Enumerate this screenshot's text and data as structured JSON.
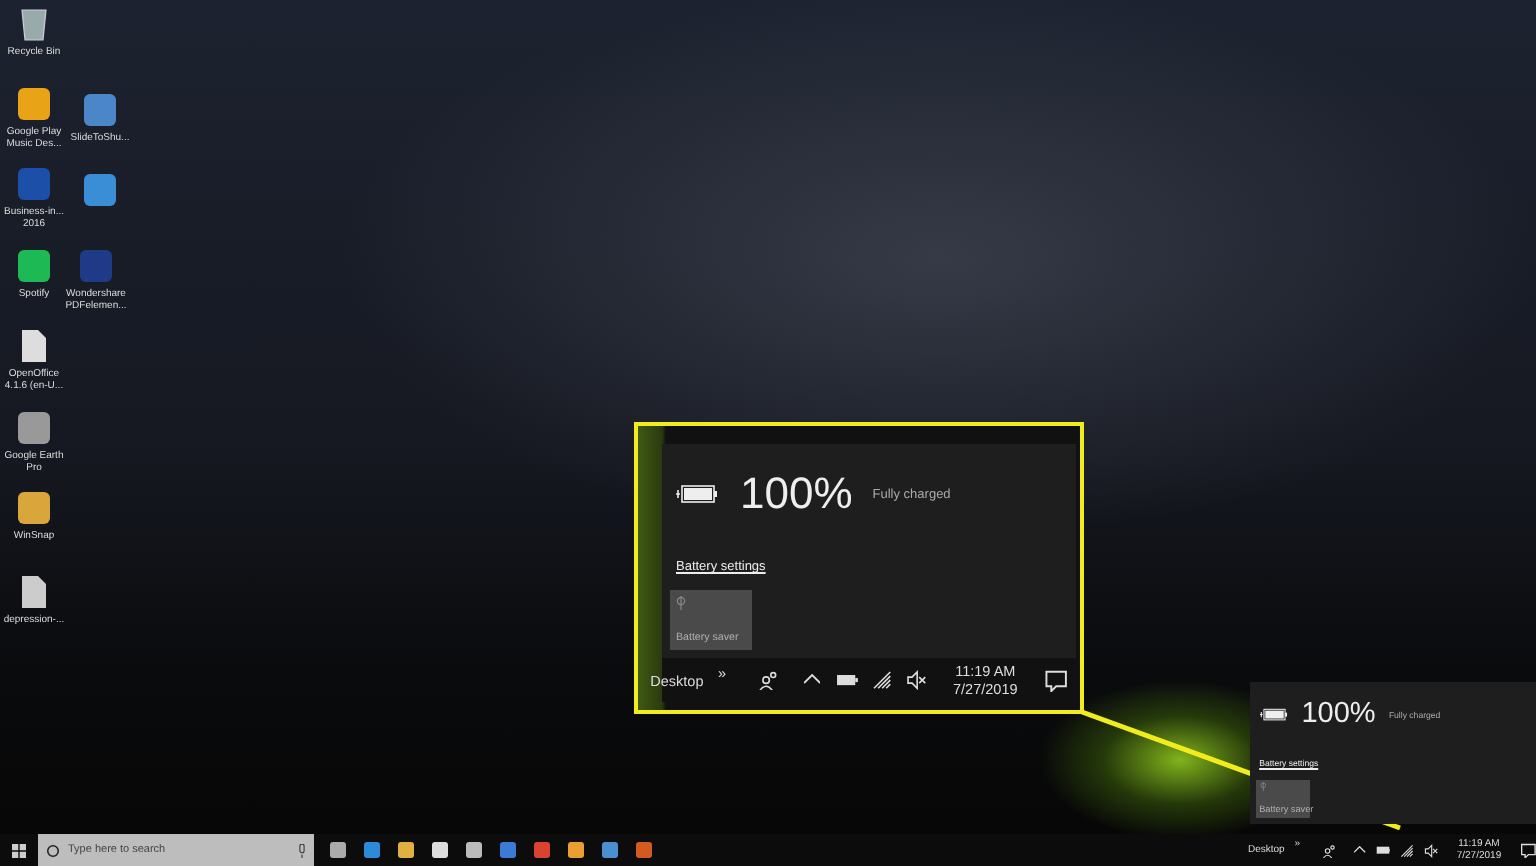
{
  "desktop_icons": [
    {
      "kind": "bin",
      "label": "Recycle Bin"
    },
    {
      "kind": "app",
      "label": "Google Play Music Des..."
    },
    {
      "kind": "app",
      "label": "SlideToShu..."
    },
    {
      "kind": "app",
      "label": "Business-in... 2016"
    },
    {
      "kind": "app"
    },
    {
      "kind": "app",
      "label": "Spotify"
    },
    {
      "kind": "app",
      "label": "Wondershare PDFelemen..."
    },
    {
      "kind": "document",
      "label": "OpenOffice 4.1.6 (en-U..."
    },
    {
      "kind": "app",
      "label": "Google Earth Pro"
    },
    {
      "kind": "app",
      "label": "WinSnap"
    },
    {
      "kind": "document",
      "label": "depression-..."
    }
  ],
  "callout": {
    "battery": {
      "level": 1,
      "percent": "100%",
      "status": "Fully charged"
    },
    "settings_link": "Battery settings",
    "battery_saver": {
      "label": "Battery saver",
      "on": false
    },
    "tray": {
      "toolbar": "Desktop",
      "overflow": "»",
      "muted": true,
      "time": "11:19 AM",
      "date": "7/27/2019"
    }
  },
  "battery_flyout": {
    "battery": {
      "level": 1,
      "percent": "100%",
      "status": "Fully charged"
    },
    "settings_link": "Battery settings",
    "battery_saver": {
      "label": "Battery saver",
      "on": false
    }
  },
  "taskbar": {
    "search": {
      "placeholder": "Type here to search"
    },
    "tray": {
      "toolbar": "Desktop",
      "overflow": "»",
      "muted": true,
      "time": "11:19 AM",
      "date": "7/27/2019"
    }
  }
}
